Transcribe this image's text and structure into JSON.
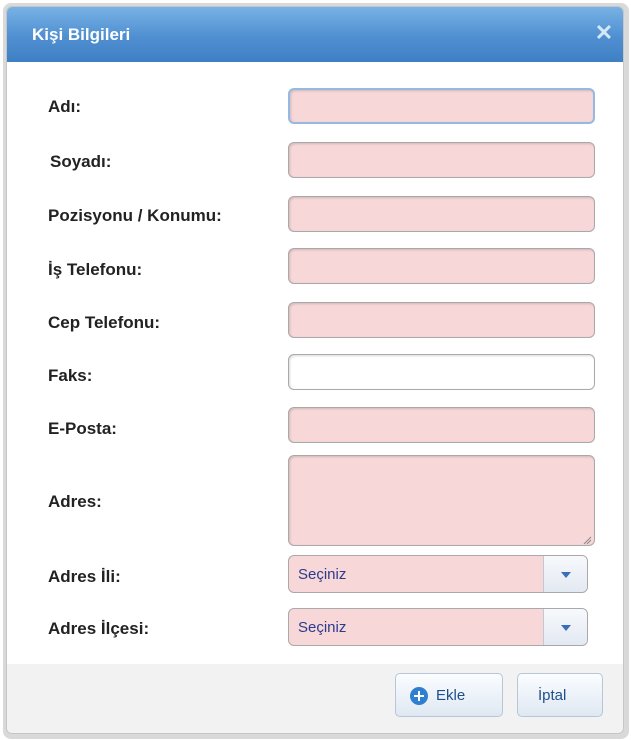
{
  "dialog": {
    "title": "Kişi Bilgileri",
    "close_icon": "close-icon"
  },
  "form": {
    "ad": {
      "label": "Adı:",
      "value": ""
    },
    "soyad": {
      "label": "Soyadı:",
      "value": ""
    },
    "pozisyon": {
      "label": "Pozisyonu / Konumu:",
      "value": ""
    },
    "is_telefonu": {
      "label": "İş Telefonu:",
      "value": ""
    },
    "cep_telefonu": {
      "label": "Cep Telefonu:",
      "value": ""
    },
    "faks": {
      "label": "Faks:",
      "value": ""
    },
    "eposta": {
      "label": "E-Posta:",
      "value": ""
    },
    "adres": {
      "label": "Adres:",
      "value": ""
    },
    "adres_ili": {
      "label": "Adres İli:",
      "selected": "Seçiniz"
    },
    "adres_ilcesi": {
      "label": "Adres İlçesi:",
      "selected": "Seçiniz"
    }
  },
  "buttons": {
    "ekle": "Ekle",
    "ekle_icon": "plus-circle-icon",
    "iptal": "İptal"
  },
  "colors": {
    "titlebar": "#4f8fd1",
    "required_field": "#f7d7d7",
    "footer": "#f2f2f2",
    "button_text": "#1e4f8c"
  }
}
